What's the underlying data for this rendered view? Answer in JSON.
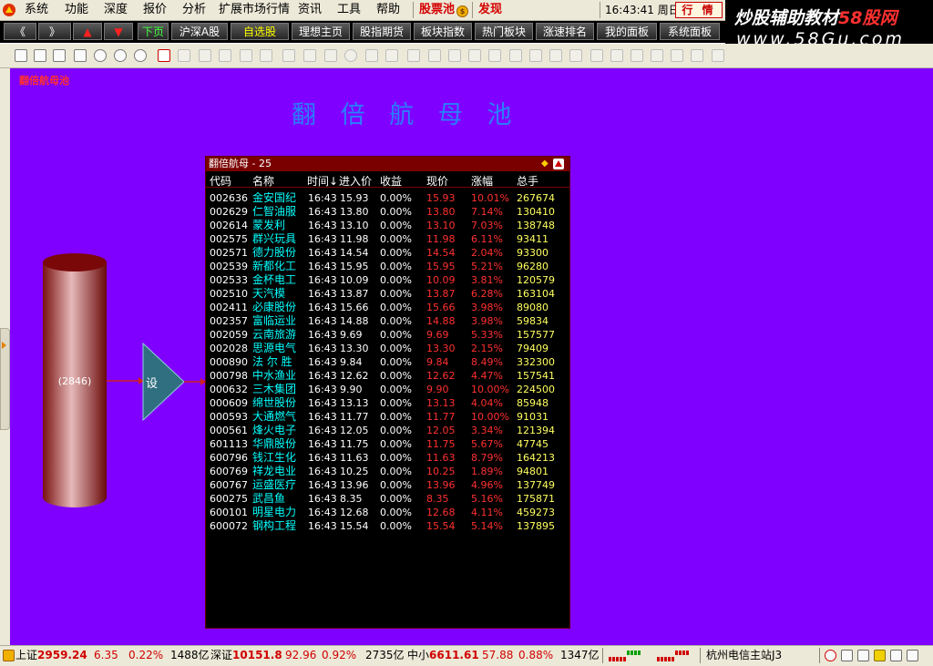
{
  "menu": {
    "items": [
      "系统",
      "功能",
      "深度",
      "报价",
      "分析",
      "扩展市场行情",
      "资讯",
      "工具",
      "帮助"
    ],
    "stock_pool": "股票池",
    "discover": "发现",
    "clock": "16:43:41 周日",
    "quote_button": "行 情"
  },
  "watermark": {
    "line1_a": "炒股辅助教材",
    "line1_b": "58股网",
    "line2": "www.58Gu.com"
  },
  "navbar": {
    "back": "《",
    "forward": "》",
    "up_arrow": "▲",
    "down_arrow": "▼",
    "buttons": [
      "下页",
      "沪深A股",
      "自选股",
      "理想主页",
      "股指期货",
      "板块指数",
      "热门板块",
      "涨速排名",
      "我的面板",
      "系统面板"
    ]
  },
  "canvas": {
    "corner_label": "翻倍航母池",
    "title": "翻 倍 航 母 池",
    "cylinder_value": "(2846)",
    "node_label": "设"
  },
  "panel": {
    "title": "翻倍航母 - 25",
    "diamond": "◆",
    "columns": [
      "代码",
      "名称",
      "时间↓",
      "进入价",
      "收益",
      "现价",
      "涨幅",
      "总手"
    ],
    "rows": [
      [
        "002636",
        "金安国纪",
        "16:43",
        "15.93",
        "0.00%",
        "15.93",
        "10.01%",
        "267674"
      ],
      [
        "002629",
        "仁智油服",
        "16:43",
        "13.80",
        "0.00%",
        "13.80",
        "7.14%",
        "130410"
      ],
      [
        "002614",
        "蒙发利",
        "16:43",
        "13.10",
        "0.00%",
        "13.10",
        "7.03%",
        "138748"
      ],
      [
        "002575",
        "群兴玩具",
        "16:43",
        "11.98",
        "0.00%",
        "11.98",
        "6.11%",
        "93411"
      ],
      [
        "002571",
        "德力股份",
        "16:43",
        "14.54",
        "0.00%",
        "14.54",
        "2.04%",
        "93300"
      ],
      [
        "002539",
        "新都化工",
        "16:43",
        "15.95",
        "0.00%",
        "15.95",
        "5.21%",
        "96280"
      ],
      [
        "002533",
        "金杯电工",
        "16:43",
        "10.09",
        "0.00%",
        "10.09",
        "3.81%",
        "120579"
      ],
      [
        "002510",
        "天汽模",
        "16:43",
        "13.87",
        "0.00%",
        "13.87",
        "6.28%",
        "163104"
      ],
      [
        "002411",
        "必康股份",
        "16:43",
        "15.66",
        "0.00%",
        "15.66",
        "3.98%",
        "89080"
      ],
      [
        "002357",
        "富临运业",
        "16:43",
        "14.88",
        "0.00%",
        "14.88",
        "3.98%",
        "59834"
      ],
      [
        "002059",
        "云南旅游",
        "16:43",
        "9.69",
        "0.00%",
        "9.69",
        "5.33%",
        "157577"
      ],
      [
        "002028",
        "思源电气",
        "16:43",
        "13.30",
        "0.00%",
        "13.30",
        "2.15%",
        "79409"
      ],
      [
        "000890",
        "法 尔 胜",
        "16:43",
        "9.84",
        "0.00%",
        "9.84",
        "8.49%",
        "332300"
      ],
      [
        "000798",
        "中水渔业",
        "16:43",
        "12.62",
        "0.00%",
        "12.62",
        "4.47%",
        "157541"
      ],
      [
        "000632",
        "三木集团",
        "16:43",
        "9.90",
        "0.00%",
        "9.90",
        "10.00%",
        "224500"
      ],
      [
        "000609",
        "绵世股份",
        "16:43",
        "13.13",
        "0.00%",
        "13.13",
        "4.04%",
        "85948"
      ],
      [
        "000593",
        "大通燃气",
        "16:43",
        "11.77",
        "0.00%",
        "11.77",
        "10.00%",
        "91031"
      ],
      [
        "000561",
        "烽火电子",
        "16:43",
        "12.05",
        "0.00%",
        "12.05",
        "3.34%",
        "121394"
      ],
      [
        "601113",
        "华鼎股份",
        "16:43",
        "11.75",
        "0.00%",
        "11.75",
        "5.67%",
        "47745"
      ],
      [
        "600796",
        "钱江生化",
        "16:43",
        "11.63",
        "0.00%",
        "11.63",
        "8.79%",
        "164213"
      ],
      [
        "600769",
        "祥龙电业",
        "16:43",
        "10.25",
        "0.00%",
        "10.25",
        "1.89%",
        "94801"
      ],
      [
        "600767",
        "运盛医疗",
        "16:43",
        "13.96",
        "0.00%",
        "13.96",
        "4.96%",
        "137749"
      ],
      [
        "600275",
        "武昌鱼",
        "16:43",
        "8.35",
        "0.00%",
        "8.35",
        "5.16%",
        "175871"
      ],
      [
        "600101",
        "明星电力",
        "16:43",
        "12.68",
        "0.00%",
        "12.68",
        "4.11%",
        "459273"
      ],
      [
        "600072",
        "钢构工程",
        "16:43",
        "15.54",
        "0.00%",
        "15.54",
        "5.14%",
        "137895"
      ]
    ]
  },
  "status": {
    "sh_label": "上证",
    "sh_index": "2959.24",
    "sh_change": "6.35",
    "sh_pct": "0.22%",
    "sh_amount": "1488亿",
    "sz_label": "深证",
    "sz_index": "10151.8",
    "sz_change": "92.96",
    "sz_pct": "0.92%",
    "sz_amount": "2735亿",
    "zx_label": "中小",
    "zx_index": "6611.61",
    "zx_change": "57.88",
    "zx_pct": "0.88%",
    "zx_amount": "1347亿",
    "server": "杭州电信主站J3"
  },
  "colors": {
    "canvas": "#8000ff",
    "up": "#ff3030",
    "name": "#00ffff",
    "title": "#2a7fff"
  }
}
